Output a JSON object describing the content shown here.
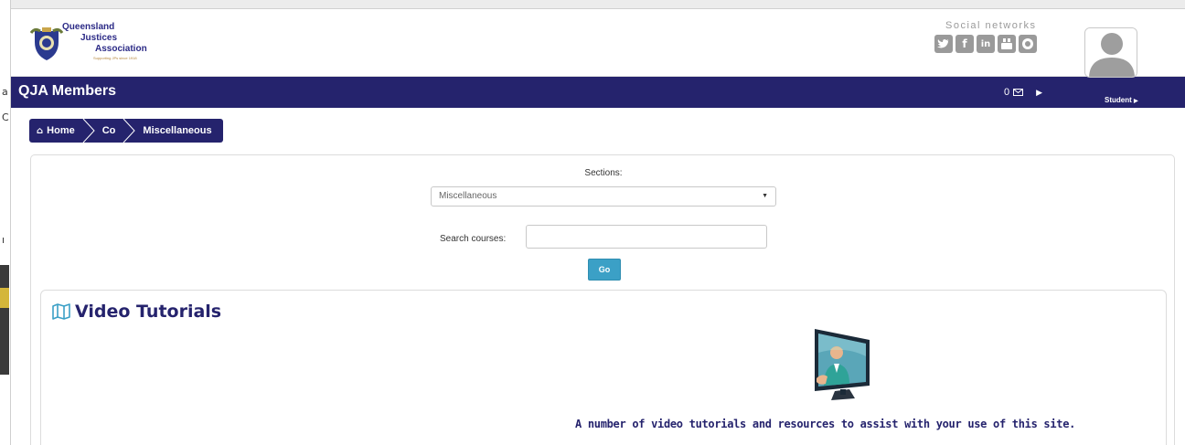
{
  "header": {
    "logo": {
      "line1": "Queensland",
      "line2": "Justices",
      "line3": "Association",
      "tagline": "Supporting JPs since 1918"
    },
    "social": {
      "label": "Social networks",
      "icons": [
        "twitter-icon",
        "facebook-icon",
        "linkedin-icon",
        "youtube-icon",
        "chat-icon"
      ]
    }
  },
  "navbar": {
    "title": "QJA Members",
    "mail_count": "0",
    "user_label": "Student"
  },
  "breadcrumb": {
    "items": [
      "Home",
      "Co",
      "Miscellaneous"
    ]
  },
  "search": {
    "sections_label": "Sections:",
    "sections_selected": "Miscellaneous",
    "search_label": "Search courses:",
    "search_value": "",
    "go_label": "Go"
  },
  "video_tutorials": {
    "title": "Video Tutorials",
    "description": "A number of video tutorials and resources to assist with your use of this site."
  },
  "colors": {
    "brand": "#25236d",
    "accent": "#3ba0c6",
    "social_gray": "#9a9a9a"
  }
}
